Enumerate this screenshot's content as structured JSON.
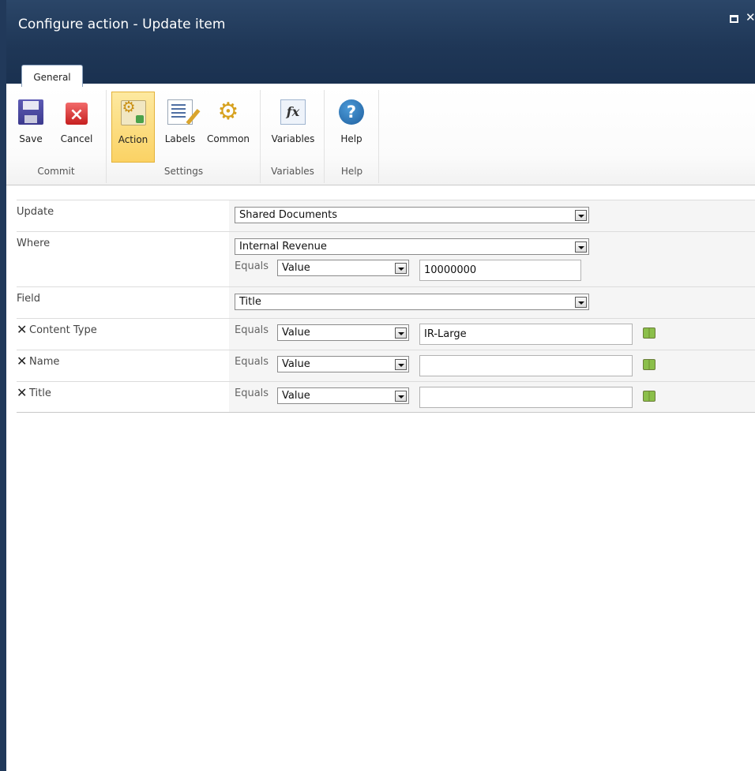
{
  "window": {
    "title": "Configure action - Update item"
  },
  "tabs": [
    {
      "label": "General"
    }
  ],
  "ribbon": {
    "groups": [
      {
        "label": "Commit",
        "buttons": [
          {
            "label": "Save",
            "icon": "save-icon"
          },
          {
            "label": "Cancel",
            "icon": "cancel-icon"
          }
        ]
      },
      {
        "label": "Settings",
        "buttons": [
          {
            "label": "Action",
            "icon": "action-icon",
            "selected": true
          },
          {
            "label": "Labels",
            "icon": "labels-icon"
          },
          {
            "label": "Common",
            "icon": "common-icon"
          }
        ]
      },
      {
        "label": "Variables",
        "buttons": [
          {
            "label": "Variables",
            "icon": "variables-icon"
          }
        ]
      },
      {
        "label": "Help",
        "buttons": [
          {
            "label": "Help",
            "icon": "help-icon"
          }
        ]
      }
    ]
  },
  "form": {
    "update": {
      "label": "Update",
      "value": "Shared Documents"
    },
    "where": {
      "label": "Where",
      "value": "Internal Revenue",
      "operator": "Equals",
      "type": "Value",
      "input": "10000000"
    },
    "field": {
      "label": "Field",
      "value": "Title"
    },
    "fields": [
      {
        "label": "Content Type",
        "operator": "Equals",
        "type": "Value",
        "input": "IR-Large"
      },
      {
        "label": "Name",
        "operator": "Equals",
        "type": "Value",
        "input": ""
      },
      {
        "label": "Title",
        "operator": "Equals",
        "type": "Value",
        "input": ""
      }
    ]
  },
  "colors": {
    "title_bar": "#1f3757",
    "selected_button": "#fbd264"
  }
}
